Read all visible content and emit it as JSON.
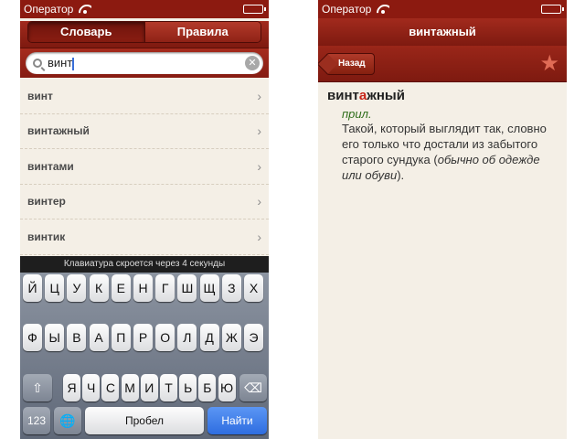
{
  "status": {
    "carrier": "Оператор"
  },
  "left": {
    "tabs": [
      {
        "label": "Словарь"
      },
      {
        "label": "Правила"
      }
    ],
    "search": {
      "value": "винт"
    },
    "results": [
      {
        "label": "винт"
      },
      {
        "label": "винтажный"
      },
      {
        "label": "винтами"
      },
      {
        "label": "винтер"
      },
      {
        "label": "винтик"
      }
    ],
    "keyboard": {
      "notice": "Клавиатура скроется через 4 секунды",
      "row1": [
        "Й",
        "Ц",
        "У",
        "К",
        "Е",
        "Н",
        "Г",
        "Ш",
        "Щ",
        "З",
        "Х"
      ],
      "row2": [
        "Ф",
        "Ы",
        "В",
        "А",
        "П",
        "Р",
        "О",
        "Л",
        "Д",
        "Ж",
        "Э"
      ],
      "row3": [
        "Я",
        "Ч",
        "С",
        "М",
        "И",
        "Т",
        "Ь",
        "Б",
        "Ю"
      ],
      "numbers_key": "123",
      "space_key": "Пробел",
      "return_key": "Найти"
    }
  },
  "right": {
    "title": "винтажный",
    "back_label": "Назад",
    "entry": {
      "headword_before": "винт",
      "headword_stress": "а",
      "headword_after": "жный",
      "pos": "прил.",
      "definition_text": "Такой, который выглядит так, словно его только что достали из забытого старого сундука (",
      "definition_note": "обычно об одежде или обуви",
      "definition_end": ")."
    }
  },
  "colors": {
    "leather_red": "#8c1a10",
    "stress_red": "#c8261a",
    "pos_green": "#2f6e1b",
    "return_blue": "#2e6de0"
  }
}
